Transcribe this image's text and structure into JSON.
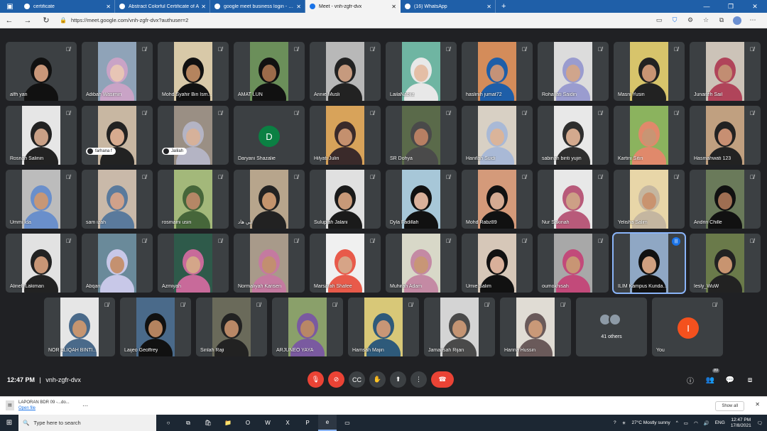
{
  "browser": {
    "tabs": [
      {
        "label": "certificate",
        "active": false
      },
      {
        "label": "Abstract Colorful Certificate of A",
        "active": false
      },
      {
        "label": "google meet business login - Bin",
        "active": false
      },
      {
        "label": "Meet - vnh-zgfr-dvx",
        "active": true
      },
      {
        "label": "(16) WhatsApp",
        "active": false
      }
    ],
    "url": "https://meet.google.com/vnh-zgfr-dvx?authuser=2"
  },
  "meeting": {
    "time": "12:47 PM",
    "code": "vnh-zgfr-dvx",
    "people_badge": "89",
    "participants": [
      {
        "name": "alfh yan",
        "skin": "#c99779",
        "hair": "#111",
        "bg": "#3c4043"
      },
      {
        "name": "Adibah Wasimin",
        "skin": "#e7c5b5",
        "hair": "#c9a3c6",
        "bg": "#8fa3b8"
      },
      {
        "name": "Mohd Syahir Bin Ism...",
        "skin": "#b5845e",
        "hair": "#111",
        "bg": "#d8c9a8"
      },
      {
        "name": "AMAT LUN",
        "skin": "#9b6b4a",
        "hair": "#111",
        "bg": "#6b8f5a"
      },
      {
        "name": "Annie Musli",
        "skin": "#c69a7e",
        "hair": "#222",
        "bg": "#b8b8b8"
      },
      {
        "name": "LailaNabila",
        "skin": "#e4bea6",
        "hair": "#e8e8e8",
        "bg": "#6fb5a2"
      },
      {
        "name": "haslinih jumat72",
        "skin": "#c49278",
        "hair": "#1e5ea8",
        "bg": "#d48c5a"
      },
      {
        "name": "Rohayati Saidin",
        "skin": "#d0a58c",
        "hair": "#9a9ccf",
        "bg": "#dcdcdc"
      },
      {
        "name": "Masni Yusin",
        "skin": "#c89473",
        "hair": "#222",
        "bg": "#d7c46b"
      },
      {
        "name": "Junaiteh Sail",
        "skin": "#c28d72",
        "hair": "#b0445a",
        "bg": "#ccc3b8"
      },
      {
        "name": "Rosnah Salinin",
        "skin": "#c9a086",
        "hair": "#222",
        "bg": "#e6e6e6"
      },
      {
        "name": "farhana f",
        "skin": "#d7ab8f",
        "hair": "#222",
        "bg": "#c8b7a2",
        "chip": "farhana f"
      },
      {
        "name": "Jalilah",
        "skin": "#d6b19a",
        "hair": "#b4b4c4",
        "bg": "#9a8f84",
        "chip": "Jalilah"
      },
      {
        "name": "Daryani Shazalie",
        "letter": "D"
      },
      {
        "name": "Hilyati Julin",
        "skin": "#c4906e",
        "hair": "#3a2a2a",
        "bg": "#d8a35a"
      },
      {
        "name": "SR Dohya",
        "skin": "#b77f63",
        "hair": "#4a4a4a",
        "bg": "#5a6a4a"
      },
      {
        "name": "Hanifah Suidi",
        "skin": "#dab49a",
        "hair": "#a9b9d6",
        "bg": "#d8d0c4"
      },
      {
        "name": "sabinah binti yujin",
        "skin": "#d3a98e",
        "hair": "#2e2e2e",
        "bg": "#e8e8e8"
      },
      {
        "name": "Kartini Sitin",
        "skin": "#c89574",
        "hair": "#e0896b",
        "bg": "#8bb35e"
      },
      {
        "name": "Hasmahwati 123",
        "skin": "#c78f72",
        "hair": "#222",
        "bg": "#c0a080"
      },
      {
        "name": "Ummi Ida",
        "skin": "#c79776",
        "hair": "#6a8fcb",
        "bg": "#bcbcbc"
      },
      {
        "name": "sam izah",
        "skin": "#d0a18a",
        "hair": "#5a7a9c",
        "bg": "#c9b9a9"
      },
      {
        "name": "rosmaini usin",
        "skin": "#b58766",
        "hair": "#46663a",
        "bg": "#a3b87a"
      },
      {
        "name": "ابي هاد",
        "skin": "#c4946d",
        "hair": "#222",
        "bg": "#b7a58c"
      },
      {
        "name": "Sulupiah Jalani",
        "skin": "#c89978",
        "hair": "#1a1a1a",
        "bg": "#e0e0e0"
      },
      {
        "name": "Dyla Fadillah",
        "skin": "#d9b09a",
        "hair": "#111",
        "bg": "#a7c7d8"
      },
      {
        "name": "Mohd Rabz89",
        "skin": "#d4aa92",
        "hair": "#111",
        "bg": "#d49a7a"
      },
      {
        "name": "Nur Sakinah",
        "skin": "#cda086",
        "hair": "#b85a7a",
        "bg": "#e8e8e8"
      },
      {
        "name": "Yelisha Salim",
        "skin": "#c9936f",
        "hair": "#c4b6a0",
        "bg": "#e8d6a8"
      },
      {
        "name": "Andrin Chille",
        "skin": "#9f6e52",
        "hair": "#111",
        "bg": "#6a7a5a"
      },
      {
        "name": "Alineh Lakiman",
        "skin": "#c89676",
        "hair": "#222",
        "bg": "#e2e2e2"
      },
      {
        "name": "Abqari",
        "skin": "#c49170",
        "hair": "#c8c8e8",
        "bg": "#6a8a9a"
      },
      {
        "name": "Azmiyah",
        "skin": "#d4a689",
        "hair": "#c86a9a",
        "bg": "#2e5a4a"
      },
      {
        "name": "Normaliyah Karisen",
        "skin": "#c28f70",
        "hair": "#c47aa0",
        "bg": "#a89a8a"
      },
      {
        "name": "Marsarah Shafee",
        "skin": "#d6a487",
        "hair": "#e85a4a",
        "bg": "#f0f0f0"
      },
      {
        "name": "Muhirah Adam",
        "skin": "#c89676",
        "hair": "#c48aa4",
        "bg": "#d8d8c8"
      },
      {
        "name": "Umie Salim",
        "skin": "#d9b09a",
        "hair": "#111",
        "bg": "#d6c7b8"
      },
      {
        "name": "oumokhisah",
        "skin": "#c89574",
        "hair": "#c24a7a",
        "bg": "#a8a8a8"
      },
      {
        "name": "ILIM Kampus Kunda...",
        "skin": "#d0a080",
        "hair": "#111",
        "bg": "#8fa7c4",
        "speaking": true
      },
      {
        "name": "Iesly_WuW",
        "skin": "#c89470",
        "hair": "#222",
        "bg": "#6a7a4a"
      },
      {
        "name": "NOR ALIQAH BINTI...",
        "skin": "#c69570",
        "hair": "#4a6a8a",
        "bg": "#e6e6e6"
      },
      {
        "name": "Laijeo Geoffrey",
        "skin": "#b4835f",
        "hair": "#111",
        "bg": "#4a6a8a"
      },
      {
        "name": "Sinlah Raji",
        "skin": "#b98866",
        "hair": "#222",
        "bg": "#6a6a5a"
      },
      {
        "name": "ARJUNEO YAYA",
        "skin": "#b88766",
        "hair": "#7a5aa0",
        "bg": "#8aa06a"
      },
      {
        "name": "Hamsah Majin",
        "skin": "#c89676",
        "hair": "#2e5a7a",
        "bg": "#d8c878"
      },
      {
        "name": "Jamairsah Rijan",
        "skin": "#c49473",
        "hair": "#4a4a4a",
        "bg": "#d4d4d4"
      },
      {
        "name": "Harina Hussin",
        "skin": "#c99978",
        "hair": "#6a5a5a",
        "bg": "#e0dcd4"
      }
    ],
    "others_label": "41 others",
    "you_label": "You",
    "you_letter": "I",
    "letter_color": "#0b8043",
    "you_color": "#f4511e"
  },
  "downloads": {
    "file_name": "LAPORAN BDR 09 -...do...",
    "action": "Open file",
    "show_all": "Show all"
  },
  "taskbar": {
    "search_placeholder": "Type here to search",
    "weather": "27°C  Mostly sunny",
    "lang": "ENG",
    "time": "12:47 PM",
    "date": "17/8/2021"
  }
}
